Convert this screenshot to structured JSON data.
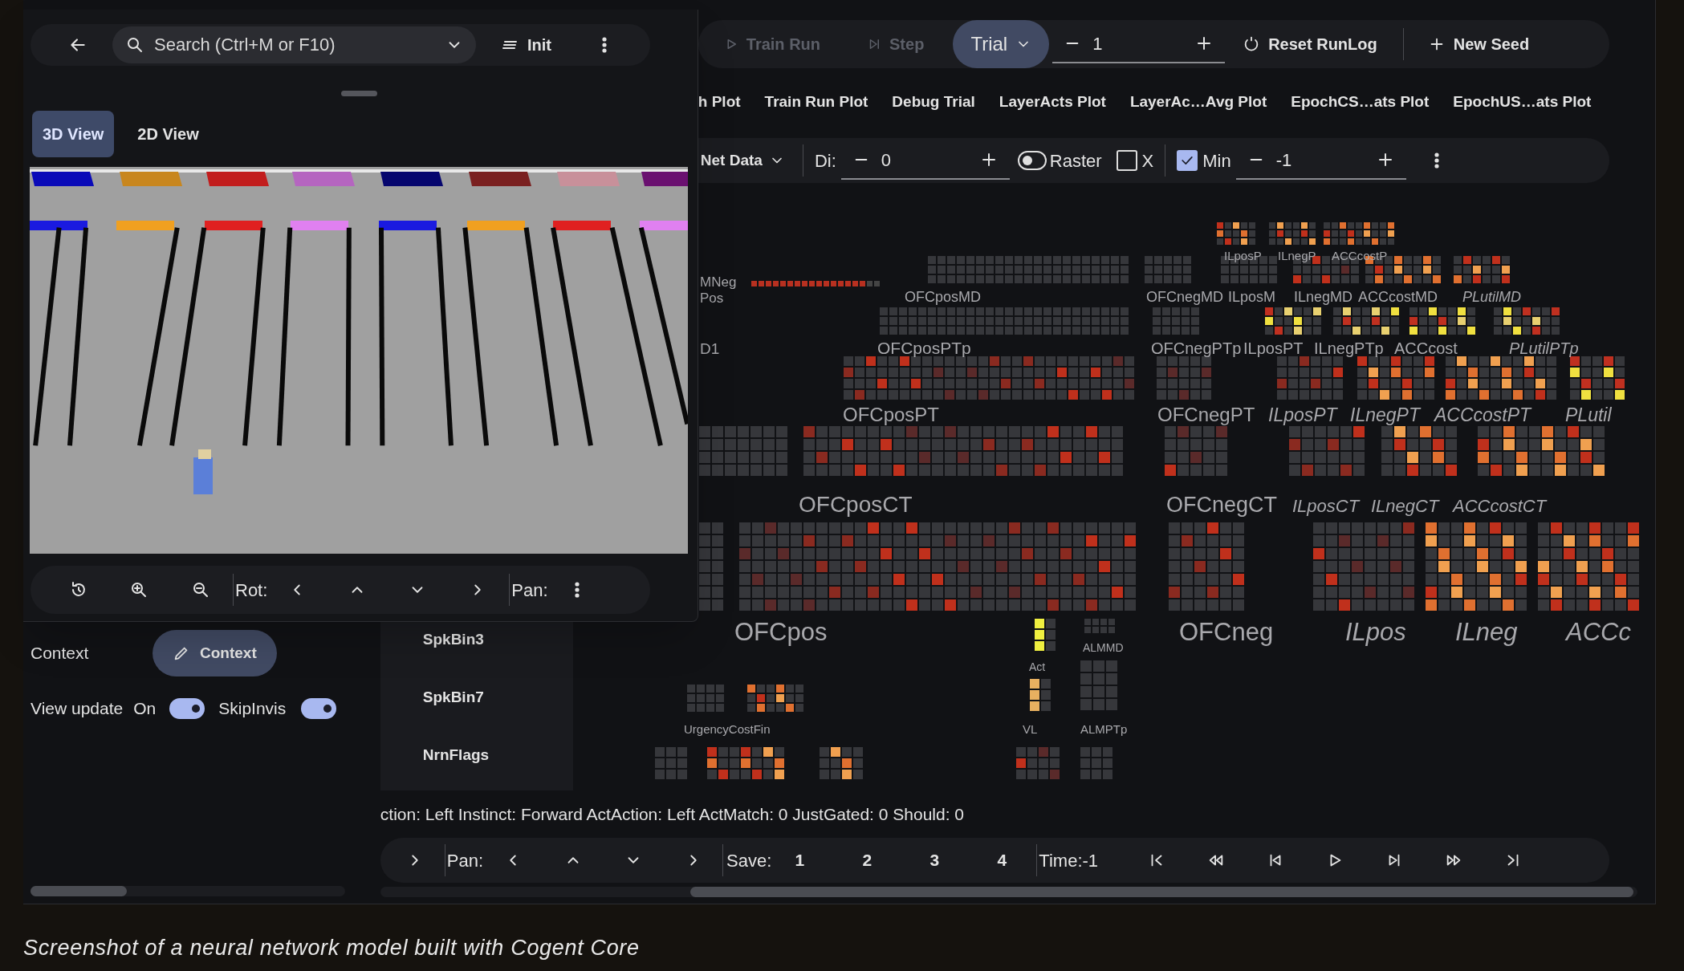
{
  "dialog": {
    "search": {
      "placeholder": "Search (Ctrl+M or F10)"
    },
    "init_button": "Init",
    "view_tabs": [
      {
        "label": "3D View",
        "selected": true
      },
      {
        "label": "2D View",
        "selected": false
      }
    ],
    "scene_toolbar": {
      "rot_label": "Rot:",
      "pan_label": "Pan:"
    }
  },
  "left_panel": {
    "context_label": "Context",
    "context_button": "Context",
    "view_update_label": "View update",
    "view_update_state": "On",
    "view_update_switch": {
      "on": true
    },
    "skip_invis_label": "SkipInvis",
    "skip_invis_switch": {
      "on": true
    }
  },
  "toolbar": {
    "buttons": [
      {
        "label": "Train Run",
        "kind": "play",
        "disabled": true
      },
      {
        "label": "Step",
        "kind": "step",
        "disabled": true
      }
    ],
    "level_chooser": "Trial",
    "spinner_value": "1",
    "reset_button": "Reset RunLog",
    "seed_button": "New Seed"
  },
  "plot_tabs": [
    {
      "label": "h Plot",
      "selected": false
    },
    {
      "label": "Train Run Plot",
      "selected": false
    },
    {
      "label": "Debug Trial",
      "selected": false
    },
    {
      "label": "LayerActs Plot",
      "selected": false
    },
    {
      "label": "LayerAc…Avg Plot",
      "selected": false
    },
    {
      "label": "EpochCS…ats Plot",
      "selected": false
    },
    {
      "label": "EpochUS…ats Plot",
      "selected": false
    }
  ],
  "net_toolbar": {
    "data_menu": "Net Data",
    "di_label": "Di:",
    "di_value": "0",
    "raster": {
      "label": "Raster",
      "on": false
    },
    "x_checkbox": {
      "label": "X",
      "checked": false
    },
    "min_checkbox": {
      "label": "Min",
      "checked": true
    },
    "min_value": "-1"
  },
  "layer_list": [
    "SpkBin3",
    "SpkBin7",
    "NrnFlags"
  ],
  "net_view": {
    "layers": [
      "MNeg",
      "Pos",
      "D1",
      "ILposP",
      "ILnegP",
      "ACCcostP",
      "OFCposMD",
      "OFCnegMD",
      "ILposM",
      "ILnegMD",
      "ACCcostMD",
      "PLutilMD",
      "OFCposPTp",
      "OFCnegPTp",
      "ILposPT",
      "ILnegPTp",
      "ACCcost",
      "PLutilPTp",
      "OFCposPT",
      "OFCnegPT",
      "ILposPT",
      "ILnegPT",
      "ACCcostPT",
      "PLutil",
      "OFCposCT",
      "OFCnegCT",
      "ILposCT",
      "ILnegCT",
      "ACCcostCT",
      "OFCpos",
      "OFCneg",
      "ILpos",
      "ILneg",
      "ACCc",
      "Act",
      "ALMMD",
      "UrgencyCostFin",
      "VL",
      "ALMPTp"
    ]
  },
  "status_text": "ction: Left Instinct: Forward ActAction: Left ActMatch: 0 JustGated: 0 Should: 0",
  "playback_toolbar": {
    "pan_label": "Pan:",
    "save_label": "Save:",
    "save_slots": [
      "1",
      "2",
      "3",
      "4"
    ],
    "time_label": "Time:-1"
  },
  "caption": "Screenshot of a neural network model built with Cogent Core"
}
